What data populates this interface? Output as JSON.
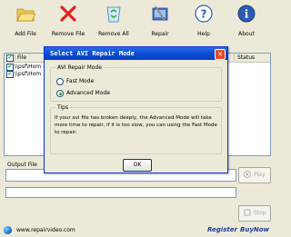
{
  "toolbar": {
    "items": [
      {
        "label": "Add File",
        "icon": "folder-open-icon"
      },
      {
        "label": "Remove File",
        "icon": "red-x-icon"
      },
      {
        "label": "Remove All",
        "icon": "recycle-bin-icon"
      },
      {
        "label": "Repair",
        "icon": "tools-icon"
      },
      {
        "label": "Help",
        "icon": "help-question-icon"
      },
      {
        "label": "About",
        "icon": "info-icon"
      }
    ]
  },
  "file_list": {
    "columns": [
      "File",
      "Status"
    ],
    "rows": [
      {
        "checked": true,
        "file": "\\\\psf\\Hom"
      },
      {
        "checked": true,
        "file": "\\\\psf\\Hom"
      }
    ]
  },
  "output": {
    "label": "Output File",
    "value": "",
    "play_label": "Play",
    "stop_label": "Stop"
  },
  "status_bar": {
    "website": "www.repairvideo.com",
    "register": "Register",
    "buynow": "BuyNow"
  },
  "dialog": {
    "title": "Select AVI Repair Mode",
    "mode_group_label": "AVI Repair Mode",
    "options": [
      "Fast Mode",
      "Advanced Mode"
    ],
    "selected_option": "Advanced Mode",
    "tips_label": "Tips",
    "tips_text": "If your avi file has broken deeply, the Advanced Mode will take more time to repair, if it is too slow, you can using the Fast Mode to repair.",
    "ok_label": "OK"
  },
  "colors": {
    "title_bar": "#0A4DD6",
    "brand_link": "#1D3F9E"
  }
}
